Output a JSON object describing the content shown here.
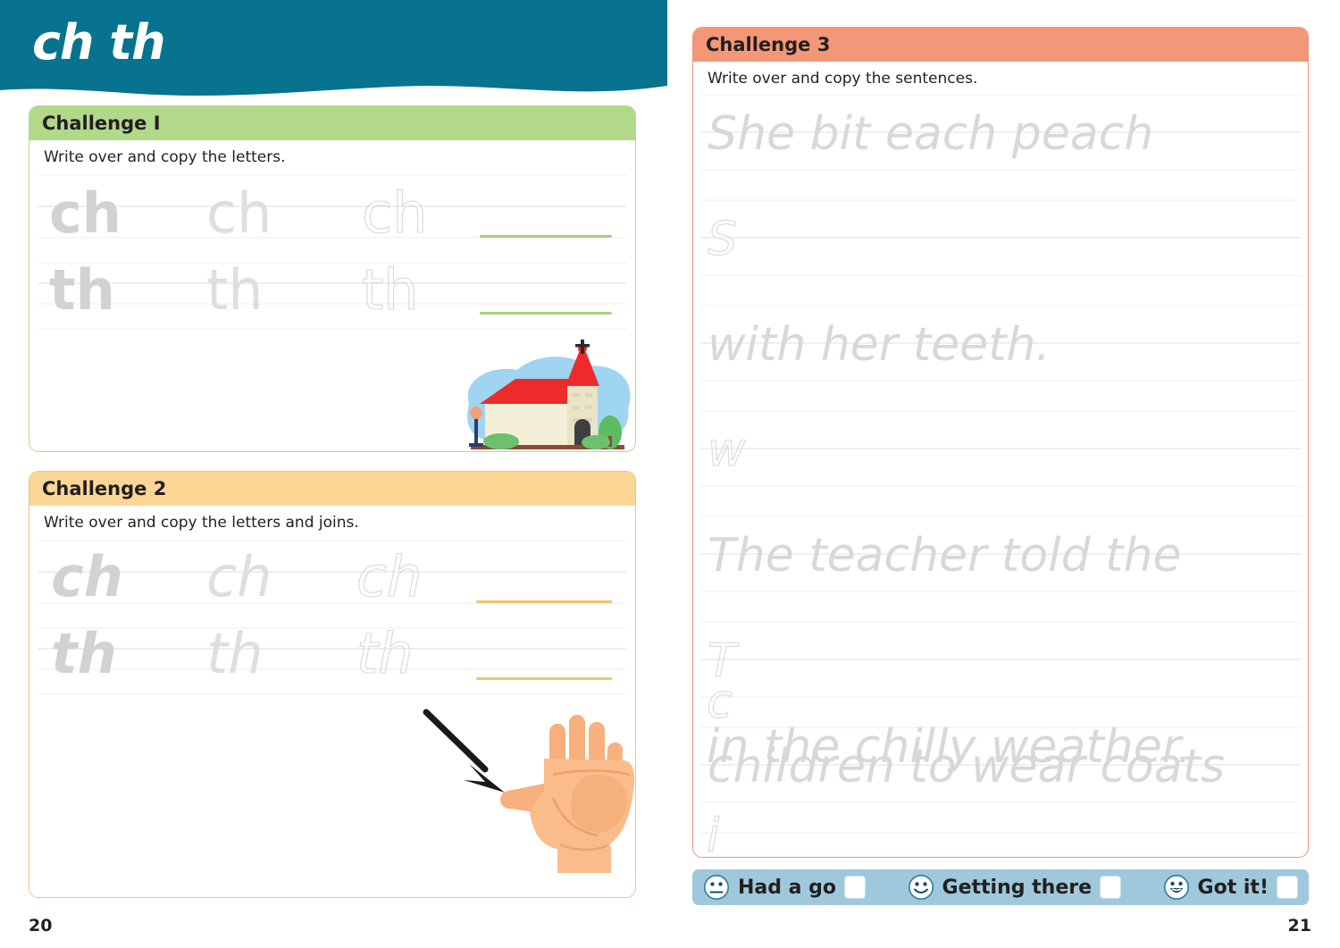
{
  "spread": {
    "left_page_number": "20",
    "right_page_number": "21"
  },
  "header": {
    "title": "ch th",
    "background_color": "#07738F"
  },
  "colors": {
    "teal": "#07738F",
    "green": "#B2D88A",
    "green_border": "#B9D88A",
    "green_line": "#A9CF7D",
    "orange": "#FBD695",
    "orange_border": "#F3C374",
    "orange_line": "#F6C26A",
    "coral": "#F29878",
    "coral_border": "#EF9479",
    "assess_bar": "#9FC8DC",
    "trace_grey": "#D8D8D8"
  },
  "challenge1": {
    "header": "Challenge I",
    "instruction": "Write over and copy the letters.",
    "rows": [
      {
        "letters": "ch",
        "traces": [
          "dark",
          "mid",
          "dotted"
        ]
      },
      {
        "letters": "th",
        "traces": [
          "dark",
          "mid",
          "dotted"
        ]
      }
    ],
    "illustration": "church-illustration"
  },
  "challenge2": {
    "header": "Challenge 2",
    "instruction": "Write over and copy the letters and joins.",
    "rows": [
      {
        "letters": "ch",
        "traces": [
          "dark",
          "mid",
          "dotted"
        ]
      },
      {
        "letters": "th",
        "traces": [
          "dark",
          "mid",
          "dotted"
        ]
      }
    ],
    "illustration": "hand-with-arrow-illustration"
  },
  "challenge3": {
    "header": "Challenge 3",
    "instruction": "Write over and copy the sentences.",
    "lines": [
      {
        "trace": "She bit each peach",
        "starter": "S"
      },
      {
        "trace": "with her teeth.",
        "starter": "w"
      },
      {
        "trace": "The teacher told the",
        "starter": "T"
      },
      {
        "trace": "children to wear coats",
        "starter": "c"
      },
      {
        "trace": "in the chilly weather.",
        "starter": "i"
      }
    ]
  },
  "assessment": {
    "items": [
      {
        "label": "Had a go",
        "face": "neutral-face-icon"
      },
      {
        "label": "Getting there",
        "face": "smile-face-icon"
      },
      {
        "label": "Got it!",
        "face": "grin-face-icon"
      }
    ]
  }
}
